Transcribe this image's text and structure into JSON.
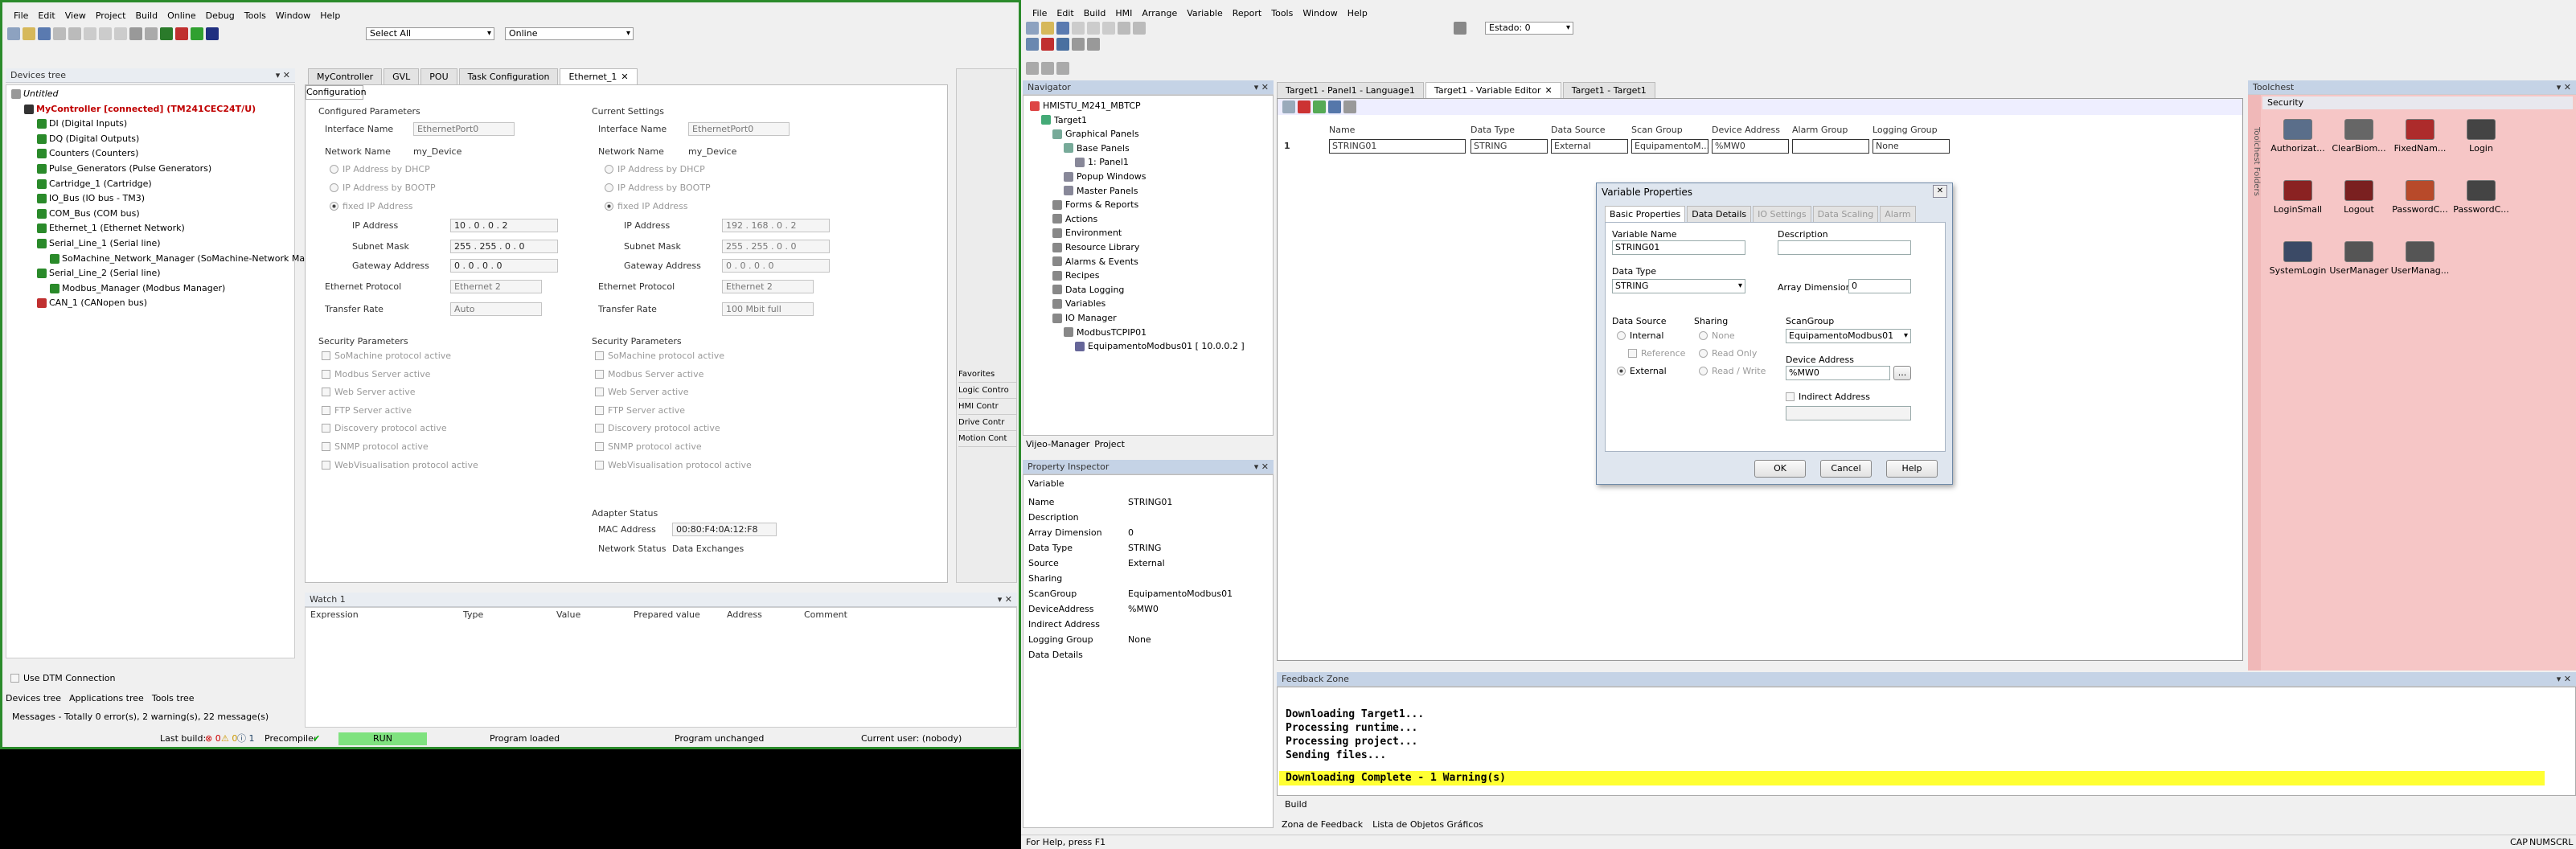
{
  "left": {
    "menu": [
      "File",
      "Edit",
      "View",
      "Project",
      "Build",
      "Online",
      "Debug",
      "Tools",
      "Window",
      "Help"
    ],
    "toolbar": {
      "select_combo": "Select All",
      "online_combo": "Online"
    },
    "devices_tree": {
      "title": "Devices tree",
      "items": [
        {
          "label": "Untitled",
          "depth": 0,
          "bold": false,
          "italic": true
        },
        {
          "label": "MyController [connected] (TM241CEC24T/U)",
          "depth": 1,
          "bold": true,
          "color": "#c00000"
        },
        {
          "label": "DI (Digital Inputs)",
          "depth": 2
        },
        {
          "label": "DQ (Digital Outputs)",
          "depth": 2
        },
        {
          "label": "Counters (Counters)",
          "depth": 2
        },
        {
          "label": "Pulse_Generators (Pulse Generators)",
          "depth": 2
        },
        {
          "label": "Cartridge_1 (Cartridge)",
          "depth": 2
        },
        {
          "label": "IO_Bus (IO bus - TM3)",
          "depth": 2
        },
        {
          "label": "COM_Bus (COM bus)",
          "depth": 2
        },
        {
          "label": "Ethernet_1 (Ethernet Network)",
          "depth": 2
        },
        {
          "label": "Serial_Line_1 (Serial line)",
          "depth": 2
        },
        {
          "label": "SoMachine_Network_Manager (SoMachine-Network Ma",
          "depth": 3
        },
        {
          "label": "Serial_Line_2 (Serial line)",
          "depth": 2
        },
        {
          "label": "Modbus_Manager (Modbus Manager)",
          "depth": 3
        },
        {
          "label": "CAN_1 (CANopen bus)",
          "depth": 2
        }
      ],
      "dtm_checkbox": "Use DTM Connection",
      "bottom_tabs": [
        "Devices tree",
        "Applications tree",
        "Tools tree"
      ],
      "messages": "Messages - Totally 0 error(s), 2 warning(s), 22 message(s)"
    },
    "editor_tabs": [
      "MyController",
      "GVL",
      "POU",
      "Task Configuration",
      "Ethernet_1"
    ],
    "config_tab": "Configuration",
    "configured": {
      "title": "Configured Parameters",
      "interface_label": "Interface Name",
      "interface_value": "EthernetPort0",
      "network_label": "Network Name",
      "network_value": "my_Device",
      "dhcp": "IP Address by DHCP",
      "bootp": "IP Address by BOOTP",
      "fixed": "fixed IP Address",
      "ip_label": "IP Address",
      "ip": [
        "10",
        "0",
        "0",
        "2"
      ],
      "mask_label": "Subnet Mask",
      "mask": [
        "255",
        "255",
        "0",
        "0"
      ],
      "gw_label": "Gateway Address",
      "gw": [
        "0",
        "0",
        "0",
        "0"
      ],
      "proto_label": "Ethernet Protocol",
      "proto": "Ethernet 2",
      "rate_label": "Transfer Rate",
      "rate": "Auto"
    },
    "current": {
      "title": "Current Settings",
      "interface_label": "Interface Name",
      "interface_value": "EthernetPort0",
      "network_label": "Network Name",
      "network_value": "my_Device",
      "dhcp": "IP Address by DHCP",
      "bootp": "IP Address by BOOTP",
      "fixed": "fixed IP Address",
      "ip_label": "IP Address",
      "ip": [
        "192",
        "168",
        "0",
        "2"
      ],
      "mask_label": "Subnet Mask",
      "mask": [
        "255",
        "255",
        "0",
        "0"
      ],
      "gw_label": "Gateway Address",
      "gw": [
        "0",
        "0",
        "0",
        "0"
      ],
      "proto_label": "Ethernet Protocol",
      "proto": "Ethernet 2",
      "rate_label": "Transfer Rate",
      "rate": "100 Mbit full"
    },
    "security": {
      "title": "Security Parameters",
      "items": [
        "SoMachine protocol active",
        "Modbus Server active",
        "Web Server active",
        "FTP Server active",
        "Discovery protocol active",
        "SNMP protocol active",
        "WebVisualisation protocol active"
      ]
    },
    "adapter": {
      "title": "Adapter Status",
      "mac_label": "MAC Address",
      "mac": "00:80:F4:0A:12:F8",
      "status_label": "Network Status",
      "status": "Data Exchanges"
    },
    "side_panel": {
      "items": [
        "Favorites",
        "Logic Contro",
        "HMI Contr",
        "Drive Contr",
        "Motion Cont"
      ]
    },
    "watch": {
      "title": "Watch 1",
      "columns": [
        "Expression",
        "Type",
        "Value",
        "Prepared value",
        "Address",
        "Comment"
      ]
    },
    "status": {
      "last_build": "Last build:",
      "errors": "0",
      "warnings": "0",
      "infos": "1",
      "precompile": "Precompile:",
      "run": "RUN",
      "program_loaded": "Program loaded",
      "program_unchanged": "Program unchanged",
      "user": "Current user: (nobody)"
    }
  },
  "right": {
    "menu": [
      "File",
      "Edit",
      "Build",
      "HMI",
      "Arrange",
      "Variable",
      "Report",
      "Tools",
      "Window",
      "Help"
    ],
    "toolbar": {
      "estado": "Estado: 0"
    },
    "navigator": {
      "title": "Navigator",
      "items": [
        {
          "label": "HMISTU_M241_MBTCP",
          "depth": 0
        },
        {
          "label": "Target1",
          "depth": 1
        },
        {
          "label": "Graphical Panels",
          "depth": 2
        },
        {
          "label": "Base Panels",
          "depth": 3
        },
        {
          "label": "1: Panel1",
          "depth": 4
        },
        {
          "label": "Popup Windows",
          "depth": 3
        },
        {
          "label": "Master Panels",
          "depth": 3
        },
        {
          "label": "Forms & Reports",
          "depth": 2
        },
        {
          "label": "Actions",
          "depth": 2
        },
        {
          "label": "Environment",
          "depth": 2
        },
        {
          "label": "Resource Library",
          "depth": 2
        },
        {
          "label": "Alarms & Events",
          "depth": 2
        },
        {
          "label": "Recipes",
          "depth": 2
        },
        {
          "label": "Data Logging",
          "depth": 2
        },
        {
          "label": "Variables",
          "depth": 2
        },
        {
          "label": "IO Manager",
          "depth": 2
        },
        {
          "label": "ModbusTCPIP01",
          "depth": 3
        },
        {
          "label": "EquipamentoModbus01 [ 10.0.0.2 ]",
          "depth": 4
        }
      ],
      "bottom_tabs": [
        "Vijeo-Manager",
        "Project"
      ]
    },
    "property_inspector": {
      "title": "Property Inspector",
      "header": "Variable",
      "rows": [
        {
          "k": "Name",
          "v": "STRING01"
        },
        {
          "k": "Description",
          "v": ""
        },
        {
          "k": "Array Dimension",
          "v": "0"
        },
        {
          "k": "Data Type",
          "v": "STRING"
        },
        {
          "k": "Source",
          "v": "External"
        },
        {
          "k": "Sharing",
          "v": ""
        },
        {
          "k": "ScanGroup",
          "v": "EquipamentoModbus01"
        },
        {
          "k": "DeviceAddress",
          "v": "%MW0"
        },
        {
          "k": "Indirect Address",
          "v": ""
        },
        {
          "k": "Logging Group",
          "v": "None"
        },
        {
          "k": "Data Details",
          "v": ""
        }
      ]
    },
    "doc_tabs": [
      "Target1 - Panel1 - Language1",
      "Target1 - Variable Editor",
      "Target1 - Target1"
    ],
    "var_table": {
      "columns": [
        "Name",
        "Data Type",
        "Data Source",
        "Scan Group",
        "Device Address",
        "Alarm Group",
        "Logging Group"
      ],
      "rows": [
        {
          "num": "1",
          "cells": [
            "STRING01",
            "STRING",
            "External",
            "EquipamentoM...",
            "%MW0",
            "",
            "None"
          ]
        }
      ]
    },
    "dialog": {
      "title": "Variable Properties",
      "tabs": [
        "Basic Properties",
        "Data Details",
        "IO Settings",
        "Data Scaling",
        "Alarm"
      ],
      "var_name_label": "Variable Name",
      "var_name": "STRING01",
      "desc_label": "Description",
      "desc": "",
      "data_type_label": "Data Type",
      "data_type": "STRING",
      "array_label": "Array Dimension",
      "array": "0",
      "source_label": "Data Source",
      "src_internal": "Internal",
      "src_reference": "Reference",
      "src_external": "External",
      "sharing_label": "Sharing",
      "sh_none": "None",
      "sh_readonly": "Read Only",
      "sh_readwrite": "Read / Write",
      "scangroup_label": "ScanGroup",
      "scangroup": "EquipamentoModbus01",
      "devaddr_label": "Device Address",
      "devaddr": "%MW0",
      "browse": "...",
      "indirect_label": "Indirect Address",
      "indirect": "",
      "ok": "OK",
      "cancel": "Cancel",
      "help": "Help"
    },
    "toolchest": {
      "title": "Toolchest",
      "section": "Security",
      "side_label": "Toolchest Folders",
      "items": [
        {
          "label": "Authorizat...",
          "color": "#5a6e8a"
        },
        {
          "label": "ClearBiom...",
          "color": "#666"
        },
        {
          "label": "FixedNam...",
          "color": "#ad2b2b"
        },
        {
          "label": "Login",
          "color": "#444"
        },
        {
          "label": "LoginSmall",
          "color": "#8a2222"
        },
        {
          "label": "Logout",
          "color": "#7a2020"
        },
        {
          "label": "PasswordC...",
          "color": "#b84a2a"
        },
        {
          "label": "PasswordC...",
          "color": "#444"
        },
        {
          "label": "SystemLogin",
          "color": "#3b4a66"
        },
        {
          "label": "UserManager",
          "color": "#555"
        },
        {
          "label": "UserManag...",
          "color": "#555"
        }
      ]
    },
    "feedback": {
      "title": "Feedback Zone",
      "lines": [
        "Downloading Target1...",
        "Processing runtime...",
        "Processing project...",
        "Sending files..."
      ],
      "complete": "Downloading Complete - 1 Warning(s)",
      "build_tab": "Build",
      "bottom_tabs": [
        "Zona de Feedback",
        "Lista de Objetos Gráficos"
      ]
    },
    "status": {
      "help": "For Help, press F1",
      "cap": "CAP",
      "num": "NUM",
      "scrl": "SCRL"
    }
  }
}
